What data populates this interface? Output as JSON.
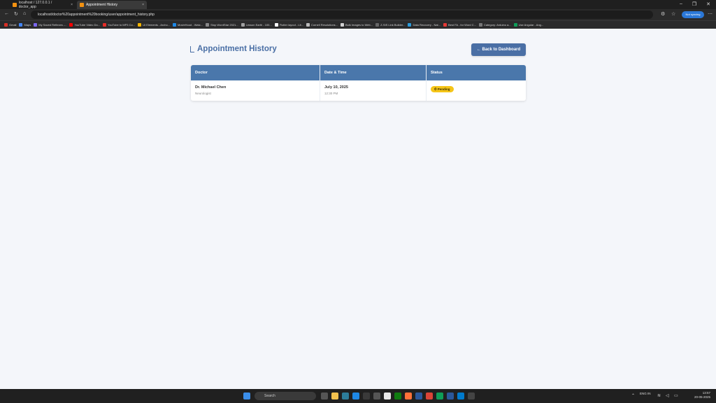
{
  "browser": {
    "tabs": [
      {
        "label": "localhost / 127.0.0.1 / doctor_app",
        "icon": "phpmyadmin-icon",
        "active": false
      },
      {
        "label": "Appointment History",
        "icon": "page-icon",
        "active": true
      }
    ],
    "url": "localhost/doctor%20appointment%20booking/user/appointment_history.php",
    "profile_label": "Not syncing",
    "bookmarks": [
      "Gmail",
      "Maps",
      "My Saved Reflexes -...",
      "YouTube Video Do...",
      "YouTube to MP3 Co...",
      "UI Elements - Archo...",
      "MovieHood - Watc...",
      "Stop WordStar 2021...",
      "Lesson Earth - 100...",
      "Flutter layout - Lit...",
      "Cornell Resolutions...",
      "Bulk Images to Web...",
      "Z-SIS Link Builder...",
      "Data Recovery - Nat...",
      "Best FA - for Word C...",
      "Category: Arduino a...",
      "Use Angular - Ang..."
    ],
    "bookmark_colors": [
      "#d93025",
      "#4285f4",
      "#7b68ee",
      "#ff0000",
      "#e52d27",
      "#f4b400",
      "#1e88e5",
      "#888888",
      "#a0a0a0",
      "#ffffff",
      "#bbbbbb",
      "#d0d0d0",
      "#666666",
      "#2d9cdb",
      "#e53935",
      "#777777",
      "#0f9d58"
    ]
  },
  "page": {
    "title": "Appointment History",
    "back_button": "← Back to Dashboard",
    "table": {
      "headers": [
        "Doctor",
        "Date & Time",
        "Status"
      ],
      "rows": [
        {
          "doctor": "Dr. Michael Chen",
          "specialty": "Neurologist",
          "date": "July 10, 2025",
          "time": "12:30 PM",
          "status": "⏱ Pending"
        }
      ]
    },
    "colors": {
      "accent": "#4a6fa5",
      "header": "#4a77ab",
      "pending": "#f5c518"
    }
  },
  "taskbar": {
    "search_placeholder": "Search",
    "tray_lang": "ENG IN",
    "time": "13:57",
    "date": "20-05-2025"
  }
}
